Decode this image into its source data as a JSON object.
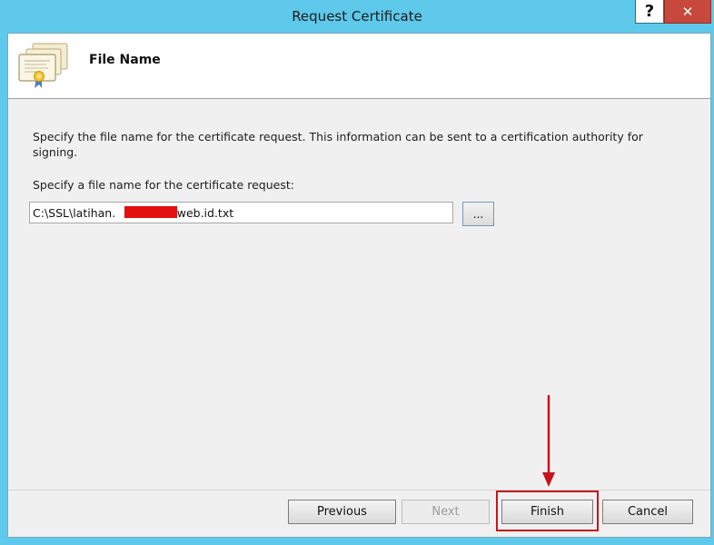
{
  "window": {
    "title": "Request Certificate",
    "help_label": "?",
    "close_label": "✕"
  },
  "header": {
    "title": "File Name",
    "icon": "certificate-icon"
  },
  "content": {
    "description": "Specify the file name for the certificate request. This information can be sent to a certification authority for signing.",
    "file_label": "Specify a file name for the certificate request:",
    "file_value": "C:\\SSL\\latihan.                .web.id.txt",
    "browse_label": "..."
  },
  "buttons": {
    "previous": "Previous",
    "next": "Next",
    "finish": "Finish",
    "cancel": "Cancel"
  },
  "annotation": {
    "color": "#c4161c"
  }
}
